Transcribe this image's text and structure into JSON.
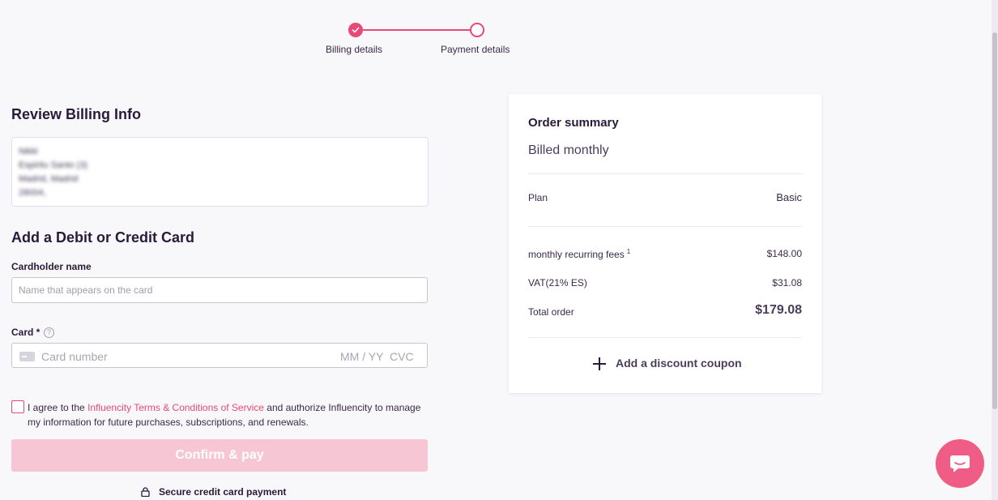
{
  "stepper": {
    "steps": [
      {
        "label": "Billing details",
        "status": "completed"
      },
      {
        "label": "Payment details",
        "status": "current"
      }
    ]
  },
  "billing": {
    "title": "Review Billing Info",
    "address_lines": [
      "Nikki",
      "Espiritu Santo (3)",
      "Madrid, Madrid",
      "28004,"
    ]
  },
  "card_form": {
    "title": "Add a Debit or Credit Card",
    "holder_label": "Cardholder name",
    "holder_placeholder": "Name that appears on the card",
    "holder_value": "",
    "card_label": "Card *",
    "card_help_icon": "?",
    "card_number_placeholder": "Card number",
    "card_expiry_placeholder": "MM / YY",
    "card_cvc_placeholder": "CVC"
  },
  "agreement": {
    "prefix": "I agree to the ",
    "link": "Influencity Terms & Conditions of Service",
    "suffix": " and authorize Influencity to manage my information for future purchases, subscriptions, and renewals.",
    "checked": false
  },
  "actions": {
    "confirm_label": "Confirm & pay",
    "secure_label": "Secure credit card payment"
  },
  "summary": {
    "title": "Order summary",
    "billing_cycle": "Billed monthly",
    "plan_label": "Plan",
    "plan_value": "Basic",
    "fees_label": "monthly recurring fees",
    "fees_sup": "1",
    "fees_value": "$148.00",
    "vat_label": "VAT(21% ES)",
    "vat_value": "$31.08",
    "total_label": "Total order",
    "total_value": "$179.08",
    "coupon_label": "Add a discount coupon"
  },
  "colors": {
    "accent": "#e84a77",
    "button_disabled": "#f7c6d5",
    "chat": "#ef5d86",
    "text": "#2a1a3a"
  },
  "icons": [
    "check-icon",
    "help-icon",
    "card-icon",
    "lock-icon",
    "plus-icon",
    "chat-icon"
  ]
}
